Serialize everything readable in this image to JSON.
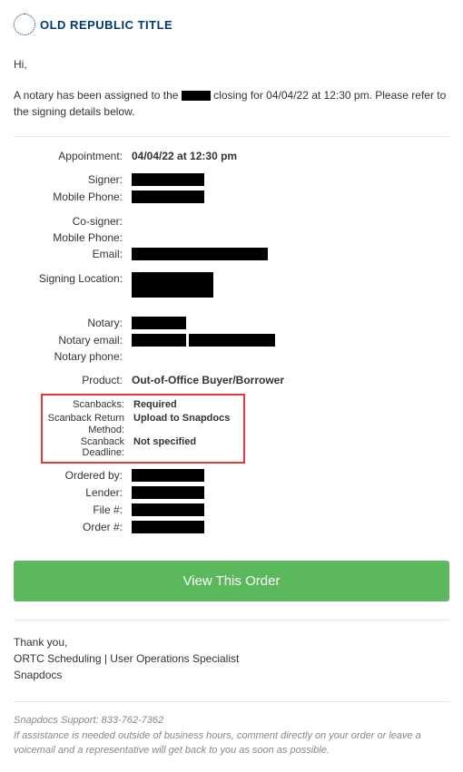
{
  "logo": {
    "text": "OLD REPUBLIC TITLE"
  },
  "greeting": "Hi,",
  "intro_before": "A notary has been assigned to the ",
  "intro_after": " closing for 04/04/22 at 12:30 pm. Please refer to the signing details below.",
  "labels": {
    "appointment": "Appointment:",
    "signer": "Signer:",
    "mobile1": "Mobile Phone:",
    "cosigner": "Co-signer:",
    "mobile2": "Mobile Phone:",
    "email": "Email:",
    "signing_location": "Signing Location:",
    "notary": "Notary:",
    "notary_email": "Notary email:",
    "notary_phone": "Notary phone:",
    "product": "Product:",
    "scanbacks": "Scanbacks:",
    "scanback_return": "Scanback Return Method:",
    "scanback_deadline": "Scanback Deadline:",
    "ordered_by": "Ordered by:",
    "lender": "Lender:",
    "file_no": "File #:",
    "order_no": "Order #:"
  },
  "values": {
    "appointment": "04/04/22 at 12:30 pm",
    "product": "Out-of-Office Buyer/Borrower",
    "scanbacks": "Required",
    "scanback_return": "Upload to Snapdocs",
    "scanback_deadline": "Not specified"
  },
  "button": "View This Order",
  "signoff": {
    "line1": "Thank you,",
    "line2": "ORTC Scheduling | User Operations Specialist",
    "line3": "Snapdocs"
  },
  "footer": {
    "support": "Snapdocs Support: 833-762-7362",
    "note": "If assistance is needed outside of business hours, comment directly on your order or leave a voicemail and a representative will get back to you as soon as possible."
  }
}
